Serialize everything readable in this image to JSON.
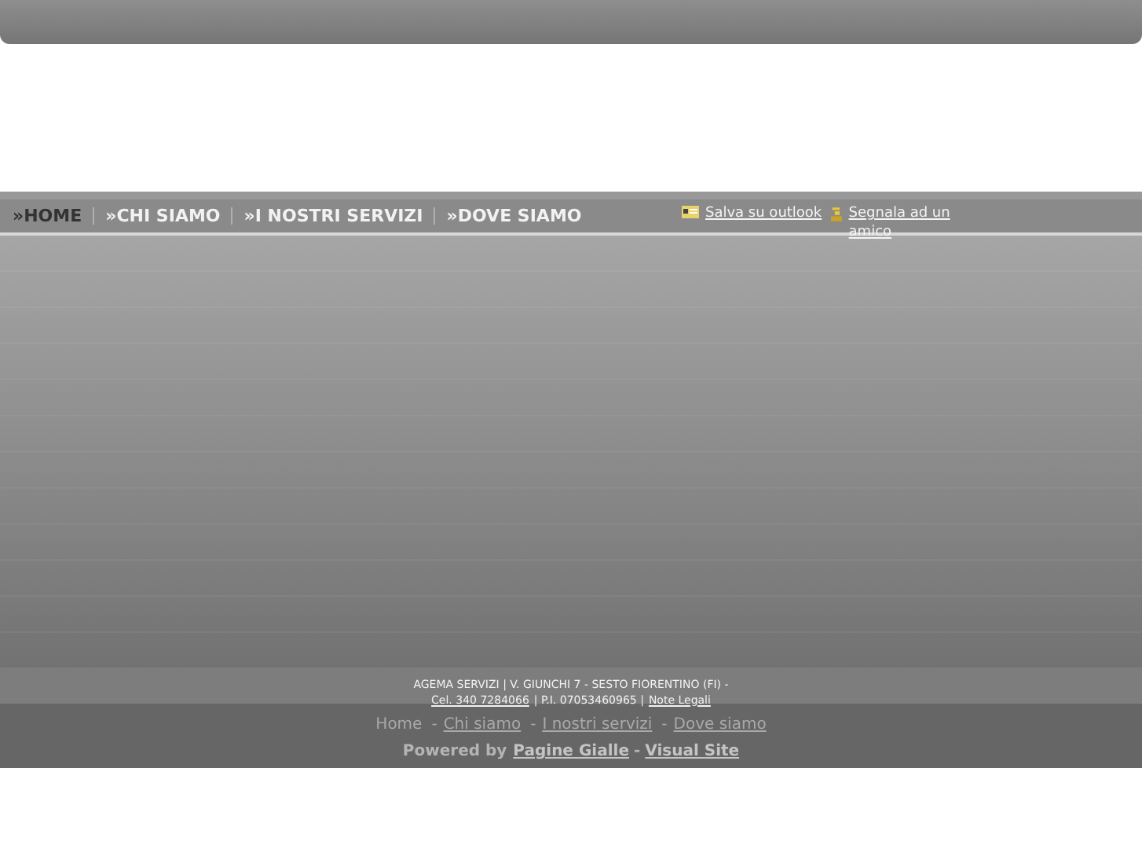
{
  "nav": [
    {
      "label": "»HOME",
      "selected": true
    },
    {
      "label": "»CHI SIAMO",
      "selected": false
    },
    {
      "label": "»I NOSTRI SERVIZI",
      "selected": false
    },
    {
      "label": "»DOVE SIAMO",
      "selected": false
    }
  ],
  "actions": [
    {
      "label": "Salva su outlook",
      "kind": "outlook"
    },
    {
      "label": "Segnala ad un amico",
      "kind": "friend"
    }
  ],
  "footer": {
    "line1": "AGEMA SERVIZI | V. GIUNCHI 7 - SESTO FIORENTINO (FI) -",
    "phone": "Cel. 340 7284066",
    "vat": "| P.I. 07053460965 |",
    "legal": "Note Legali"
  },
  "bottom_links": [
    {
      "label": "Home",
      "link": false
    },
    {
      "separator": "-",
      "label": "Chi siamo",
      "link": true
    },
    {
      "separator": "-",
      "label": "I nostri servizi",
      "link": true
    },
    {
      "separator": "-",
      "label": "Dove siamo",
      "link": true
    }
  ],
  "powered": {
    "label": "Powered by",
    "links": [
      "Pagine Gialle",
      "Visual Site"
    ],
    "separator": "-"
  }
}
